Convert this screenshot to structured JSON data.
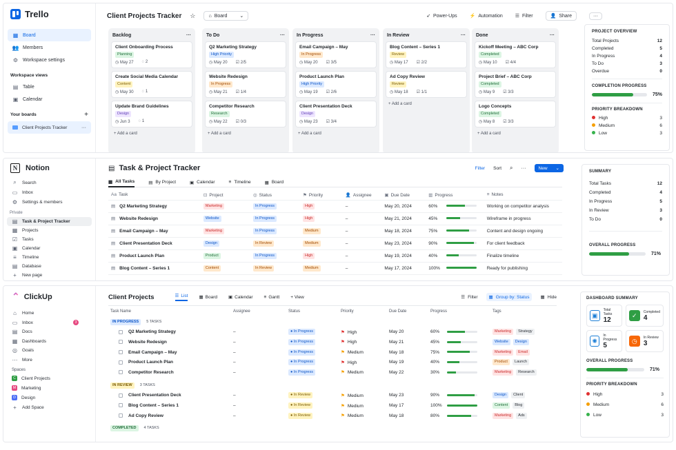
{
  "trello": {
    "logo": "Trello",
    "nav": [
      {
        "label": "Board"
      },
      {
        "label": "Members"
      },
      {
        "label": "Workspace settings"
      }
    ],
    "views_header": "Workspace views",
    "views": [
      {
        "label": "Table"
      },
      {
        "label": "Calendar"
      }
    ],
    "boards_header": "Your boards",
    "board_item": "Client Projects Tracker",
    "board_title": "Client Projects Tracker",
    "board_view": "Board",
    "toolbar": {
      "powerups": "Power-Ups",
      "automation": "Automation",
      "filter": "Filter",
      "share": "Share"
    },
    "add_card": "+  Add a card",
    "lists": [
      {
        "name": "Backlog",
        "cards": [
          {
            "title": "Client Onboarding Process",
            "tag": "Planning",
            "tagc": "green",
            "date": "May 27",
            "m2": "2"
          },
          {
            "title": "Create Social Media Calendar",
            "tag": "Content",
            "tagc": "yellow",
            "date": "May 30",
            "m2": "1"
          },
          {
            "title": "Update Brand Guidelines",
            "tag": "Design",
            "tagc": "purple",
            "date": "Jun 3",
            "m2": "1"
          }
        ]
      },
      {
        "name": "To Do",
        "cards": [
          {
            "title": "Q2 Marketing Strategy",
            "tag": "High Priority",
            "tagc": "blue",
            "date": "May 20",
            "m2": "2/5"
          },
          {
            "title": "Website Redesign",
            "tag": "In Progress",
            "tagc": "orange",
            "date": "May 21",
            "m2": "1/4"
          },
          {
            "title": "Competitor Research",
            "tag": "Research",
            "tagc": "green",
            "date": "May 22",
            "m2": "0/3"
          }
        ]
      },
      {
        "name": "In Progress",
        "cards": [
          {
            "title": "Email Campaign – May",
            "tag": "In Progress",
            "tagc": "orange",
            "date": "May 20",
            "m2": "3/5"
          },
          {
            "title": "Product Launch Plan",
            "tag": "High Priority",
            "tagc": "blue",
            "date": "May 19",
            "m2": "2/6"
          },
          {
            "title": "Client Presentation Deck",
            "tag": "Design",
            "tagc": "purple",
            "date": "May 23",
            "m2": "3/4"
          }
        ]
      },
      {
        "name": "In Review",
        "cards": [
          {
            "title": "Blog Content – Series 1",
            "tag": "Review",
            "tagc": "yellow",
            "date": "May 17",
            "m2": "2/2"
          },
          {
            "title": "Ad Copy Review",
            "tag": "Review",
            "tagc": "yellow",
            "date": "May 18",
            "m2": "1/1"
          }
        ]
      },
      {
        "name": "Done",
        "cards": [
          {
            "title": "Kickoff Meeting – ABC Corp",
            "tag": "Completed",
            "tagc": "green",
            "date": "May 10",
            "m2": "4/4"
          },
          {
            "title": "Project Brief – ABC Corp",
            "tag": "Completed",
            "tagc": "green",
            "date": "May 9",
            "m2": "3/3"
          },
          {
            "title": "Logo Concepts",
            "tag": "Completed",
            "tagc": "green",
            "date": "May 8",
            "m2": "3/3"
          }
        ]
      }
    ],
    "overview": {
      "title": "PROJECT OVERVIEW",
      "rows": [
        [
          "Total Projects",
          "12"
        ],
        [
          "Completed",
          "5"
        ],
        [
          "In Progress",
          "4"
        ],
        [
          "To Do",
          "3"
        ],
        [
          "Overdue",
          "0"
        ]
      ],
      "progress_title": "COMPLETION PROGRESS",
      "progress": "75%",
      "progress_value": 0.75,
      "priority_title": "PRIORITY BREAKDOWN",
      "priority": [
        [
          "High",
          "3",
          "#e03131"
        ],
        [
          "Medium",
          "6",
          "#f59f00"
        ],
        [
          "Low",
          "3",
          "#37b24d"
        ]
      ]
    }
  },
  "notion": {
    "logo": "Notion",
    "nav": [
      {
        "label": "Search"
      },
      {
        "label": "Inbox"
      },
      {
        "label": "Settings & members"
      }
    ],
    "private": "Private",
    "pages": [
      {
        "label": "Task & Project Tracker"
      },
      {
        "label": "Projects"
      },
      {
        "label": "Tasks"
      },
      {
        "label": "Calendar"
      },
      {
        "label": "Timeline"
      },
      {
        "label": "Database"
      },
      {
        "label": "New page"
      }
    ],
    "title": "Task & Project Tracker",
    "filter": "Filter",
    "sort": "Sort",
    "new": "New",
    "tabs": [
      {
        "label": "All Tasks"
      },
      {
        "label": "By Project"
      },
      {
        "label": "Calendar"
      },
      {
        "label": "Timeline"
      },
      {
        "label": "Board"
      }
    ],
    "headers": [
      "Task",
      "Project",
      "Status",
      "Priority",
      "Assignee",
      "Due Date",
      "Progress",
      "Notes"
    ],
    "rows": [
      {
        "task": "Q2 Marketing Strategy",
        "project": "Marketing",
        "status": "In Progress",
        "priority": "High",
        "assignee": "–",
        "due": "May 20, 2024",
        "progress": "60%",
        "pv": 0.6,
        "notes": "Working on competitor analysis"
      },
      {
        "task": "Website Redesign",
        "project": "Website",
        "status": "In Progress",
        "priority": "High",
        "assignee": "–",
        "due": "May 21, 2024",
        "progress": "45%",
        "pv": 0.45,
        "notes": "Wireframe in progress"
      },
      {
        "task": "Email Campaign – May",
        "project": "Marketing",
        "status": "In Progress",
        "priority": "Medium",
        "assignee": "–",
        "due": "May 18, 2024",
        "progress": "75%",
        "pv": 0.75,
        "notes": "Content and design ongoing"
      },
      {
        "task": "Client Presentation Deck",
        "project": "Design",
        "status": "In Review",
        "priority": "Medium",
        "assignee": "–",
        "due": "May 23, 2024",
        "progress": "90%",
        "pv": 0.9,
        "notes": "For client feedback"
      },
      {
        "task": "Product Launch Plan",
        "project": "Product",
        "status": "In Progress",
        "priority": "High",
        "assignee": "–",
        "due": "May 19, 2024",
        "progress": "40%",
        "pv": 0.4,
        "notes": "Finalize timeline"
      },
      {
        "task": "Blog Content – Series 1",
        "project": "Content",
        "status": "In Review",
        "priority": "Medium",
        "assignee": "–",
        "due": "May 17, 2024",
        "progress": "100%",
        "pv": 1.0,
        "notes": "Ready for publishing"
      }
    ],
    "summary": {
      "title": "SUMMARY",
      "rows": [
        [
          "Total Tasks",
          "12"
        ],
        [
          "Completed",
          "4"
        ],
        [
          "In Progress",
          "5"
        ],
        [
          "In Review",
          "3"
        ],
        [
          "To Do",
          "0"
        ]
      ],
      "overall": "OVERALL PROGRESS",
      "overall_pct": "71%",
      "overall_value": 0.71
    }
  },
  "clickup": {
    "logo": "ClickUp",
    "nav": [
      {
        "label": "Home"
      },
      {
        "label": "Inbox",
        "badge": "3"
      },
      {
        "label": "Docs"
      },
      {
        "label": "Dashboards"
      },
      {
        "label": "Goals"
      },
      {
        "label": "More"
      }
    ],
    "spaces_header": "Spaces",
    "spaces": [
      {
        "label": "Client Projects",
        "letter": "C",
        "color": "#2f9e44"
      },
      {
        "label": "Marketing",
        "letter": "M",
        "color": "#e64980"
      },
      {
        "label": "Design",
        "letter": "D",
        "color": "#4c6ef5"
      }
    ],
    "add_space": "Add Space",
    "title": "Client Projects",
    "views": [
      {
        "label": "List"
      },
      {
        "label": "Board"
      },
      {
        "label": "Calendar"
      },
      {
        "label": "Gantt"
      },
      {
        "label": "+ View"
      }
    ],
    "filter": "Filter",
    "group": "Group by: Status",
    "hide": "Hide",
    "headers": [
      "Task Name",
      "Assignee",
      "Status",
      "Priority",
      "Due Date",
      "Progress",
      "Tags"
    ],
    "group1": {
      "label": "IN PROGRESS",
      "count": "5 TASKS"
    },
    "group2": {
      "label": "IN REVIEW",
      "count": "3 TASKS"
    },
    "group3": {
      "label": "COMPLETED",
      "count": "4 TASKS"
    },
    "rows1": [
      {
        "task": "Q2 Marketing Strategy",
        "assignee": "–",
        "status": "In Progress",
        "priority": "High",
        "due": "May 20",
        "progress": "60%",
        "pv": 0.6,
        "tags": [
          "Marketing",
          "Strategy"
        ]
      },
      {
        "task": "Website Redesign",
        "assignee": "–",
        "status": "In Progress",
        "priority": "High",
        "due": "May 21",
        "progress": "45%",
        "pv": 0.45,
        "tags": [
          "Website",
          "Design"
        ]
      },
      {
        "task": "Email Campaign – May",
        "assignee": "–",
        "status": "In Progress",
        "priority": "Medium",
        "due": "May 18",
        "progress": "75%",
        "pv": 0.75,
        "tags": [
          "Marketing",
          "Email"
        ]
      },
      {
        "task": "Product Launch Plan",
        "assignee": "–",
        "status": "In Progress",
        "priority": "High",
        "due": "May 19",
        "progress": "40%",
        "pv": 0.4,
        "tags": [
          "Product",
          "Launch"
        ]
      },
      {
        "task": "Competitor Research",
        "assignee": "–",
        "status": "In Progress",
        "priority": "Medium",
        "due": "May 22",
        "progress": "30%",
        "pv": 0.3,
        "tags": [
          "Marketing",
          "Research"
        ]
      }
    ],
    "rows2": [
      {
        "task": "Client Presentation Deck",
        "assignee": "–",
        "status": "In Review",
        "priority": "Medium",
        "due": "May 23",
        "progress": "90%",
        "pv": 0.9,
        "tags": [
          "Design",
          "Client"
        ]
      },
      {
        "task": "Blog Content – Series 1",
        "assignee": "–",
        "status": "In Review",
        "priority": "Medium",
        "due": "May 17",
        "progress": "100%",
        "pv": 1.0,
        "tags": [
          "Content",
          "Blog"
        ]
      },
      {
        "task": "Ad Copy Review",
        "assignee": "–",
        "status": "In Review",
        "priority": "Medium",
        "due": "May 18",
        "progress": "80%",
        "pv": 0.8,
        "tags": [
          "Marketing",
          "Ads"
        ]
      }
    ],
    "dashboard": {
      "title": "DASHBOARD SUMMARY",
      "tiles": [
        {
          "label": "Total Tasks",
          "value": "12",
          "color": "#1c7ed6"
        },
        {
          "label": "Completed",
          "value": "4",
          "color": "#2f9e44"
        },
        {
          "label": "In Progress",
          "value": "5",
          "color": "#1c7ed6"
        },
        {
          "label": "In Review",
          "value": "3",
          "color": "#f76707"
        }
      ],
      "overall": "OVERALL PROGRESS",
      "overall_pct": "71%",
      "overall_value": 0.71,
      "priority_title": "PRIORITY BREAKDOWN",
      "priority": [
        [
          "High",
          "3",
          "#e03131"
        ],
        [
          "Medium",
          "6",
          "#f59f00"
        ],
        [
          "Low",
          "3",
          "#37b24d"
        ]
      ]
    }
  }
}
